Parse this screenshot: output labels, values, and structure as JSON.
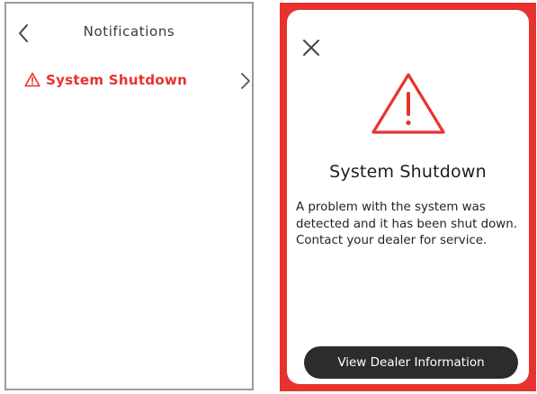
{
  "left_screen": {
    "header": {
      "title": "Notifications",
      "back_icon": "chevron-left-icon"
    },
    "notifications": [
      {
        "label": "System Shutdown",
        "icon": "warning-triangle-icon",
        "trailing_icon": "chevron-right-icon",
        "color": "#e8322d"
      }
    ]
  },
  "modal": {
    "close_icon": "close-x-icon",
    "alert_icon": "warning-triangle-icon",
    "title": "System Shutdown",
    "body": "A problem with the system was detected and it has been shut down. Contact your dealer for service.",
    "action_button_label": "View Dealer Information",
    "accent_color": "#e8322d",
    "button_color": "#2c2c2c"
  }
}
